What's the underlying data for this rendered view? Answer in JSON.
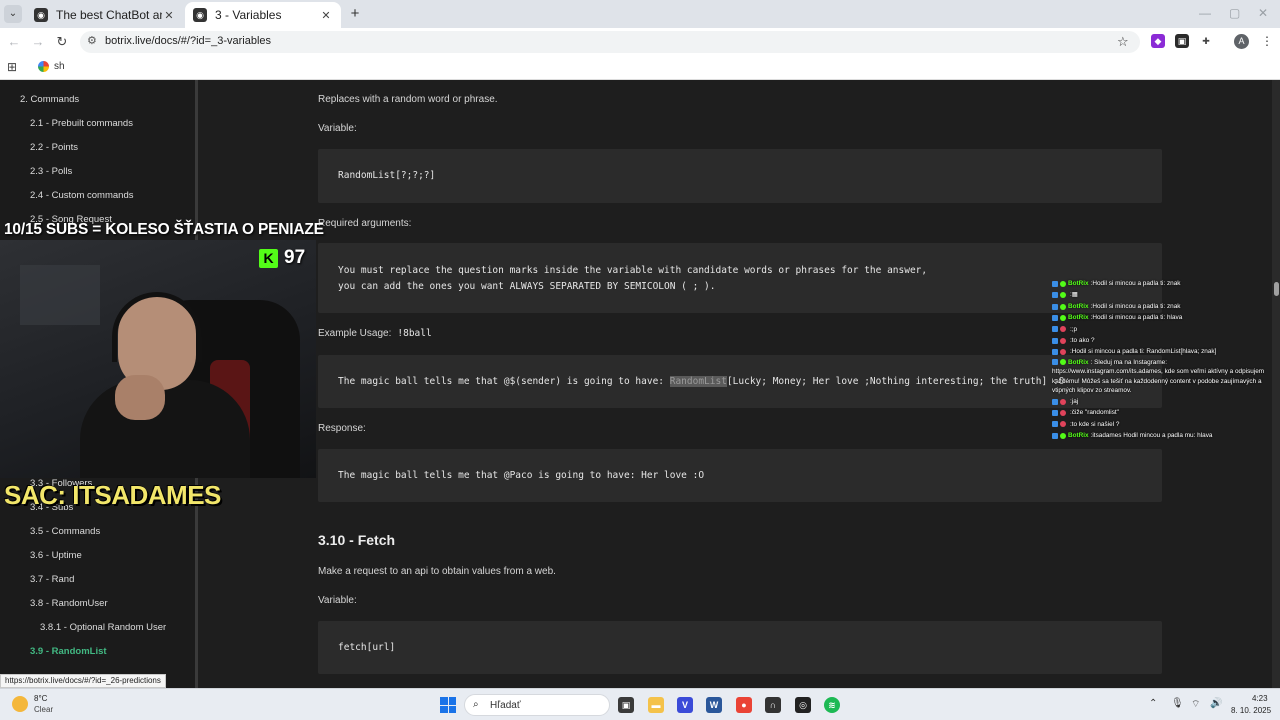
{
  "browser": {
    "tabs": [
      {
        "title": "The best ChatBot and Widgets",
        "active": false
      },
      {
        "title": "3 - Variables",
        "active": true
      }
    ],
    "url": "botrix.live/docs/#/?id=_3-variables",
    "bookmark": "sh",
    "profile_initial": "A"
  },
  "sidebar": {
    "items": [
      {
        "label": "2. Commands"
      },
      {
        "label": "2.1 - Prebuilt commands"
      },
      {
        "label": "2.2 - Points"
      },
      {
        "label": "2.3 - Polls"
      },
      {
        "label": "2.4 - Custom commands"
      },
      {
        "label": "2.5 - Song Request"
      },
      {
        "label": "3.3 - Followers"
      },
      {
        "label": "3.4 - Subs"
      },
      {
        "label": "3.5 - Commands"
      },
      {
        "label": "3.6 - Uptime"
      },
      {
        "label": "3.7 - Rand"
      },
      {
        "label": "3.8 - RandomUser"
      },
      {
        "label": "3.8.1 - Optional Random User"
      },
      {
        "label": "3.9 - RandomList",
        "active": true
      }
    ]
  },
  "content": {
    "intro": "Replaces with a random word or phrase.",
    "variable_label": "Variable:",
    "variable_code": "RandomList[?;?;?]",
    "required_label": "Required arguments:",
    "required_line1": "You must replace the question marks inside the variable with candidate words or phrases for the answer,",
    "required_line2": "you can add the ones you want ALWAYS SEPARATED BY SEMICOLON ( ; ).",
    "example_label": "Example Usage:",
    "example_cmd": "!8ball",
    "example_code_pre": "The magic ball tells me that @$(sender) is going to have: ",
    "example_code_hl": "RandomList",
    "example_code_post": "[Lucky; Money; Her love ;Nothing interesting; the truth] :O",
    "response_label": "Response:",
    "response_code": "The magic ball tells me that @Paco is going to have: Her love :O",
    "fetch_heading": "3.10 - Fetch",
    "fetch_desc": "Make a request to an api to obtain values from a web.",
    "fetch_variable_label": "Variable:",
    "fetch_code": "fetch[url]"
  },
  "overlay": {
    "title": "10/15 SUBS = KOLESO ŠŤASTIA O PENIAZE",
    "counter": "97",
    "counter_icon": "kick-icon",
    "sac": "SAC: ITSADAMES"
  },
  "chat": [
    {
      "name": "BotRix",
      "text": "Hodil si mincou a padla ti: znak",
      "color": "#53fc18"
    },
    {
      "name": "",
      "text": "",
      "color": "#53fc18",
      "emote": true
    },
    {
      "name": "BotRix",
      "text": "Hodil si mincou a padla ti: znak",
      "color": "#53fc18"
    },
    {
      "name": "BotRix",
      "text": "Hodil si mincou a padla ti: hlava",
      "color": "#53fc18"
    },
    {
      "name": "",
      "text": ";p",
      "color": "#e0435b"
    },
    {
      "name": "",
      "text": "to ako ?",
      "color": "#e0435b"
    },
    {
      "name": "",
      "text": "Hodil si mincou a padla ti: RandomList[hlava; znak]",
      "color": "#e0435b"
    },
    {
      "name": "BotRix",
      "text": "Sleduj ma na Instagrame: https://www.instagram.com/its.adames, kde som veľmi aktívny a odpisujem každému! Môžeš sa tešiť na každodenný content v podobe zaujímavých a vtipných klipov zo streamov.",
      "color": "#53fc18",
      "wrap": true
    },
    {
      "name": "",
      "text": "jaj",
      "color": "#e0435b"
    },
    {
      "name": "",
      "text": "čiže \"randomlist\"",
      "color": "#e0435b"
    },
    {
      "name": "",
      "text": "to kde si našiel ?",
      "color": "#e0435b"
    },
    {
      "name": "BotRix",
      "text": "itsadames Hodil mincou a padla mu: hlava",
      "color": "#53fc18"
    }
  ],
  "statusbar": {
    "url": "https://botrix.live/docs/#/?id=_26-predictions"
  },
  "taskbar": {
    "temp": "8°C",
    "weather": "Clear",
    "search_placeholder": "Hľadať",
    "time": "4:23",
    "date": "8. 10. 2025"
  }
}
